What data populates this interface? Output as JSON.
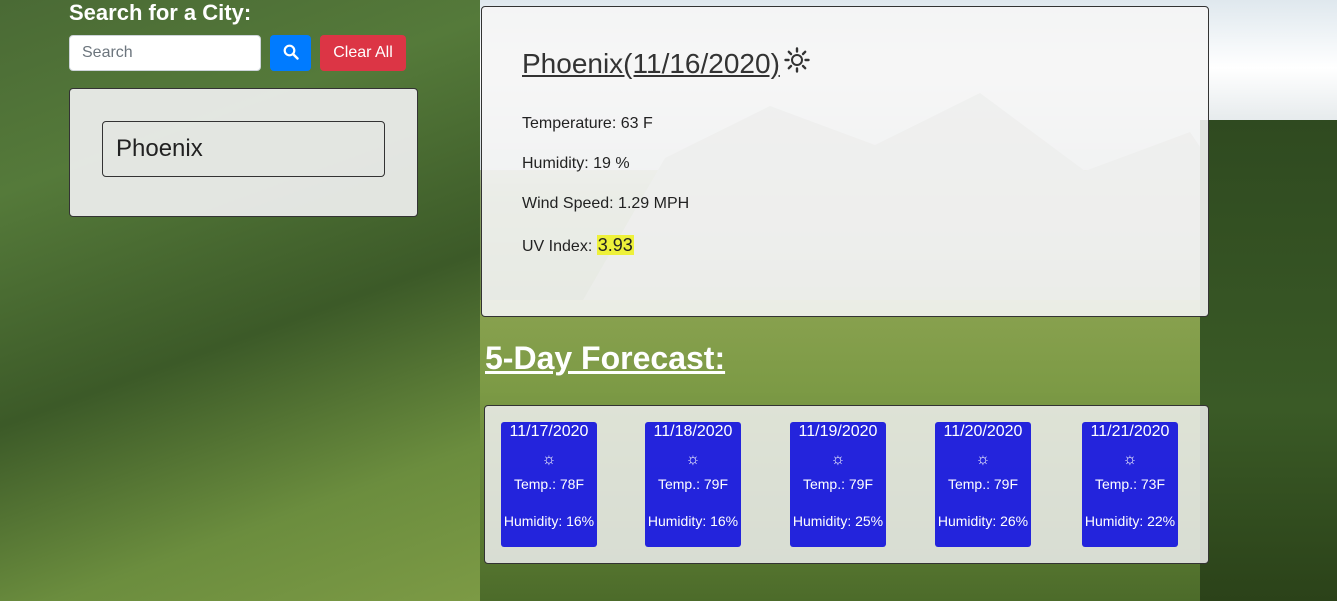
{
  "search": {
    "title": "Search for a City:",
    "placeholder": "Search",
    "value": "",
    "search_icon": "magnifier-icon",
    "clear_label": "Clear All"
  },
  "history": {
    "items": [
      "Phoenix"
    ]
  },
  "current": {
    "heading": "Phoenix(11/16/2020)",
    "icon": "sun-icon",
    "temperature": "Temperature: 63 F",
    "humidity": "Humidity: 19 %",
    "wind": "Wind Speed: 1.29 MPH",
    "uv_label": "UV Index: ",
    "uv_value": "3.93"
  },
  "forecast": {
    "title": "5-Day Forecast:",
    "days": [
      {
        "date": "11/17/2020",
        "icon": "☼",
        "temp": "Temp.: 78F",
        "humidity": "Humidity: 16%"
      },
      {
        "date": "11/18/2020",
        "icon": "☼",
        "temp": "Temp.: 79F",
        "humidity": "Humidity: 16%"
      },
      {
        "date": "11/19/2020",
        "icon": "☼",
        "temp": "Temp.: 79F",
        "humidity": "Humidity: 25%"
      },
      {
        "date": "11/20/2020",
        "icon": "☼",
        "temp": "Temp.: 79F",
        "humidity": "Humidity: 26%"
      },
      {
        "date": "11/21/2020",
        "icon": "☼",
        "temp": "Temp.: 73F",
        "humidity": "Humidity: 22%"
      }
    ]
  },
  "colors": {
    "search_button": "#007bff",
    "clear_button": "#dc3545",
    "forecast_card": "#1414dc",
    "uv_highlight": "#eef13a"
  }
}
